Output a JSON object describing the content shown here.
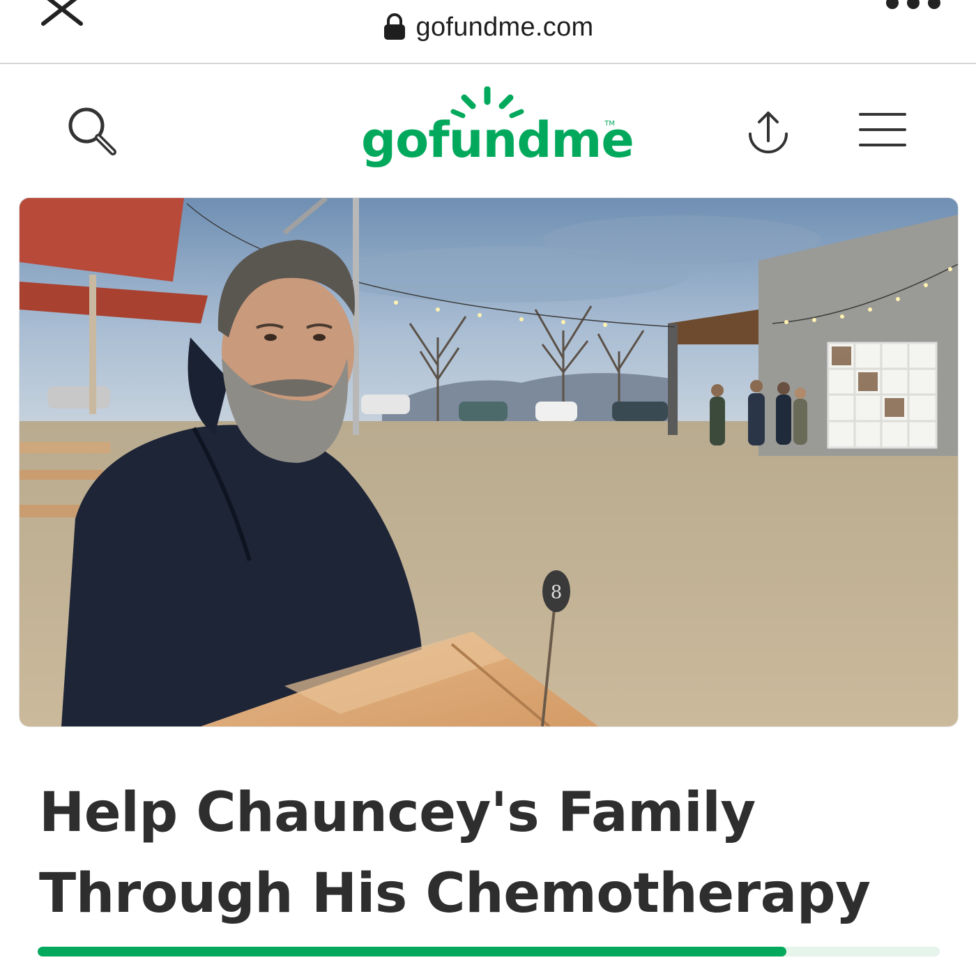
{
  "browser": {
    "url": "gofundme.com",
    "icons": {
      "close": "close-icon",
      "lock": "lock-icon",
      "more": "more-dots-icon"
    }
  },
  "header": {
    "logo_text": "gofundme",
    "logo_tm": "TM",
    "icons": {
      "search": "search-icon",
      "share": "share-icon",
      "menu": "hamburger-menu-icon"
    }
  },
  "campaign": {
    "title": "Help Chauncey's Family Through His Chemotherapy",
    "progress_fraction": 0.83
  },
  "colors": {
    "brand_green": "#02a95c",
    "progress_track": "#e6f4ec",
    "title_text": "#2e2e2e"
  }
}
